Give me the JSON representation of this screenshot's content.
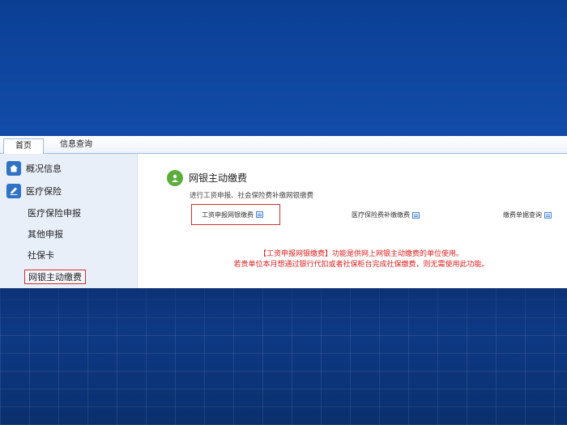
{
  "tabs": [
    {
      "label": "首页"
    },
    {
      "label": "信息查询"
    }
  ],
  "sidebar": {
    "sections": [
      {
        "label": "概况信息",
        "icon": "home-icon"
      },
      {
        "label": "医疗保险",
        "icon": "edit-icon"
      }
    ],
    "items": [
      {
        "label": "医疗保险申报"
      },
      {
        "label": "其他申报"
      },
      {
        "label": "社保卡"
      },
      {
        "label": "网银主动缴费"
      }
    ]
  },
  "main": {
    "title": "网银主动缴费",
    "title_icon": "user-badge-icon",
    "description": "进行工资申报、社会保险费补缴网银缴费",
    "links": [
      {
        "label": "工资申报网银缴费",
        "icon": "external-link-icon"
      },
      {
        "label": "医疗保险费补缴缴费",
        "icon": "external-link-icon"
      },
      {
        "label": "缴费单据查询",
        "icon": "external-link-icon"
      }
    ],
    "notice_line1": "【工资申报网银缴费】功能是供网上网银主动缴费的单位使用。",
    "notice_line2": "若贵单位本月想通过银行代扣或者社保柜台完成社保缴费，则无需使用此功能。"
  },
  "colors": {
    "highlight": "#d32f2f",
    "notice": "#e02020",
    "accent": "#2f72c6",
    "title_icon": "#5cae3c"
  }
}
